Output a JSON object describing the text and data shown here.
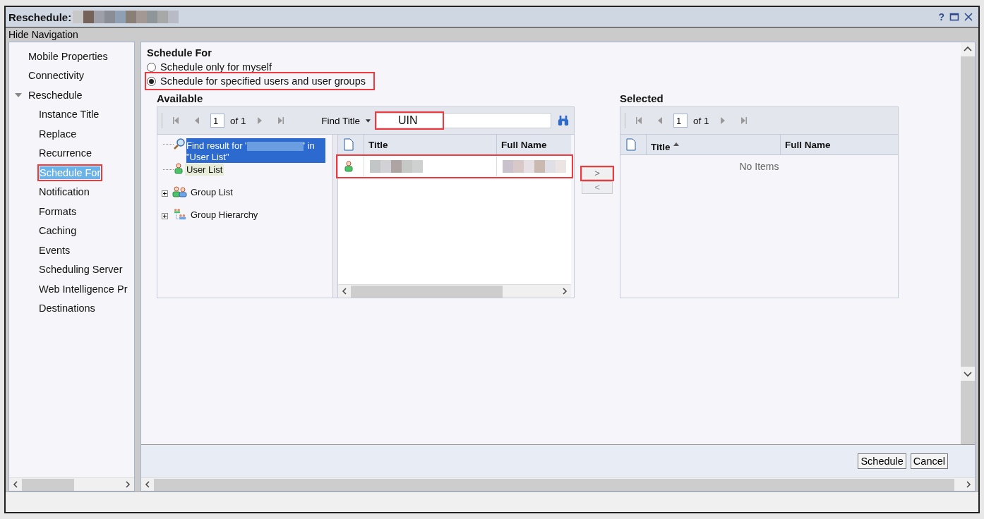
{
  "window": {
    "title": "Reschedule:",
    "help": "?"
  },
  "navigation": {
    "toggle": "Hide Navigation",
    "items": [
      {
        "label": "Mobile Properties",
        "selected": false
      },
      {
        "label": "Connectivity",
        "selected": false
      },
      {
        "label": "Reschedule",
        "selected": false,
        "expanded": true,
        "children": [
          {
            "label": "Instance Title",
            "selected": false
          },
          {
            "label": "Replace",
            "selected": false
          },
          {
            "label": "Recurrence",
            "selected": false
          },
          {
            "label": "Schedule For",
            "selected": true,
            "highlighted": true
          },
          {
            "label": "Notification",
            "selected": false
          },
          {
            "label": "Formats",
            "selected": false
          },
          {
            "label": "Caching",
            "selected": false
          },
          {
            "label": "Events",
            "selected": false
          },
          {
            "label": "Scheduling Server",
            "selected": false
          },
          {
            "label": "Web Intelligence Pr",
            "selected": false
          },
          {
            "label": "Destinations",
            "selected": false
          }
        ]
      }
    ]
  },
  "schedule_for": {
    "heading": "Schedule For",
    "options": [
      {
        "label": "Schedule only for myself",
        "selected": false,
        "highlighted": false
      },
      {
        "label": "Schedule for specified users and user groups",
        "selected": true,
        "highlighted": true
      }
    ]
  },
  "available": {
    "heading": "Available",
    "pager": {
      "page": "1",
      "of": "of 1"
    },
    "find": {
      "label": "Find Title",
      "value": "UIN",
      "highlighted": true
    },
    "tree": [
      {
        "kind": "search-result",
        "prefix": "Find result for '",
        "suffix": "' in \"User List\"",
        "selected": true
      },
      {
        "kind": "user",
        "label": "User List",
        "selected": false,
        "current": true
      },
      {
        "kind": "group",
        "label": "Group List",
        "selected": false,
        "expanded": false
      },
      {
        "kind": "hierarchy",
        "label": "Group Hierarchy",
        "selected": false,
        "expanded": false
      }
    ],
    "columns": [
      "Title",
      "Full Name"
    ],
    "rows": [
      {
        "kind": "user",
        "highlighted": true
      }
    ]
  },
  "transfer_buttons": [
    {
      "label": ">",
      "highlighted": true,
      "disabled": false
    },
    {
      "label": "<",
      "highlighted": false,
      "disabled": true
    }
  ],
  "selected_list": {
    "heading": "Selected",
    "pager": {
      "page": "1",
      "of": "of 1"
    },
    "columns": [
      {
        "label": "Title",
        "sorted": true
      },
      {
        "label": "Full Name",
        "sorted": false
      }
    ],
    "empty": "No Items"
  },
  "buttons": [
    "Schedule",
    "Cancel"
  ]
}
